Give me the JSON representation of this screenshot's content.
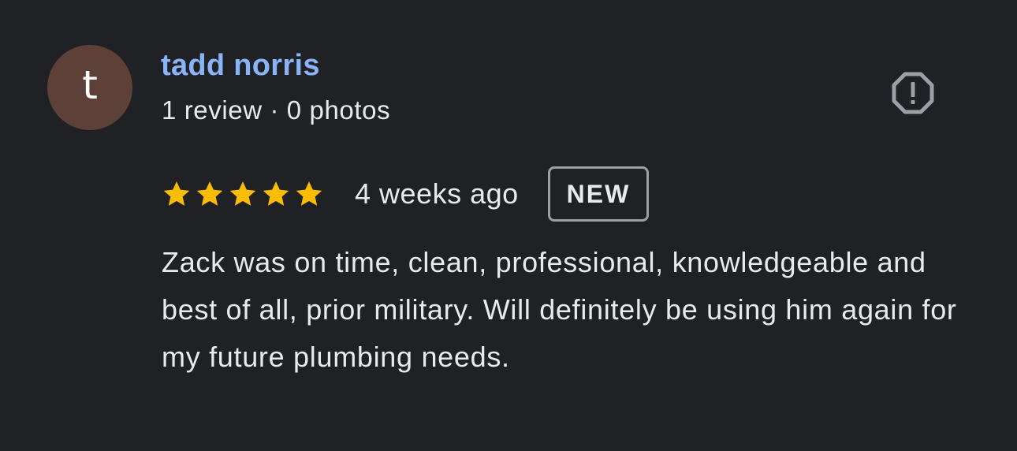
{
  "reviewer": {
    "avatar_initial": "t",
    "avatar_color": "#5d4037",
    "name": "tadd norris",
    "meta": "1 review · 0 photos"
  },
  "report": {
    "icon": "report-flag-icon"
  },
  "review": {
    "rating": 5,
    "max_rating": 5,
    "time_ago": "4 weeks ago",
    "badge": "NEW",
    "text": "Zack was on time, clean, professional, knowledgeable and best of all, prior military. Will definitely be using him again for my future plumbing needs."
  },
  "colors": {
    "background": "#202124",
    "name": "#8ab4f8",
    "text": "#e8eaed",
    "star": "#fbbc04",
    "icon": "#9aa0a6"
  }
}
